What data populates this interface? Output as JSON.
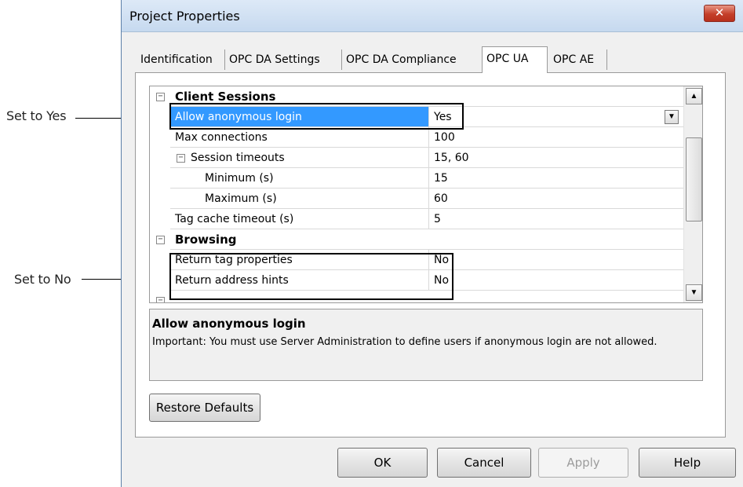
{
  "callouts": {
    "yes": "Set to Yes",
    "no": "Set to No"
  },
  "window": {
    "title": "Project Properties",
    "close_glyph": "✕"
  },
  "tabs": [
    {
      "label": "Identification"
    },
    {
      "label": "OPC DA Settings"
    },
    {
      "label": "OPC DA Compliance"
    },
    {
      "label": "OPC UA"
    },
    {
      "label": "OPC AE"
    }
  ],
  "active_tab": "OPC UA",
  "grid": {
    "rows": [
      {
        "name": "Client Sessions",
        "value": "",
        "category": true
      },
      {
        "name": "Allow anonymous login",
        "value": "Yes"
      },
      {
        "name": "Max connections",
        "value": "100"
      },
      {
        "name": "Session timeouts",
        "value": "15, 60"
      },
      {
        "name": "Minimum (s)",
        "value": "15"
      },
      {
        "name": "Maximum (s)",
        "value": "60"
      },
      {
        "name": "Tag cache timeout (s)",
        "value": "5"
      },
      {
        "name": "Browsing",
        "value": "",
        "category": true
      },
      {
        "name": "Return tag properties",
        "value": "No"
      },
      {
        "name": "Return address hints",
        "value": "No"
      }
    ],
    "expander_glyph": "−",
    "dropdown_glyph": "▼",
    "scroll_up_glyph": "▲",
    "scroll_down_glyph": "▼"
  },
  "description": {
    "title": "Allow anonymous login",
    "body": "Important:  You must use Server Administration to define users if anonymous login are not allowed."
  },
  "buttons": {
    "restore": "Restore Defaults",
    "ok": "OK",
    "cancel": "Cancel",
    "apply": "Apply",
    "help": "Help"
  },
  "colors": {
    "selection": "#3399ff",
    "close_button": "#c43f2a"
  }
}
